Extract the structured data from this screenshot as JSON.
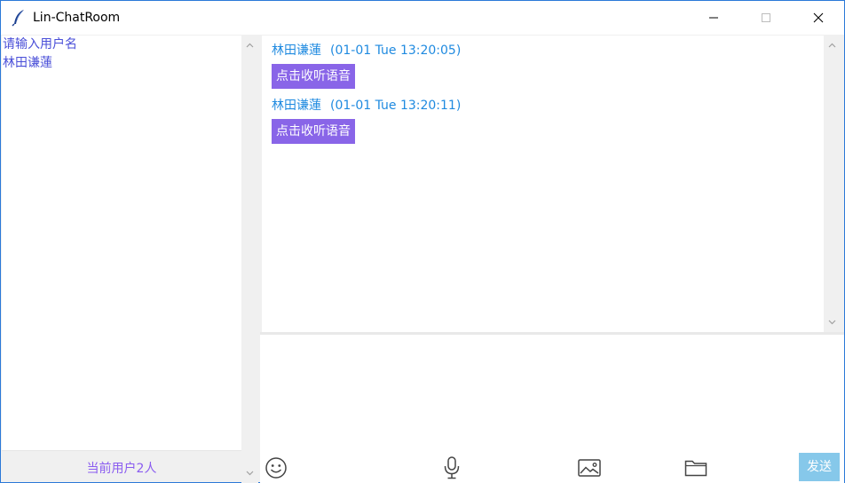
{
  "window": {
    "title": "Lin-ChatRoom",
    "border_color": "#2b79d8"
  },
  "sidebar": {
    "items": [
      {
        "label": "请输入用户名"
      },
      {
        "label": "林田谦蓮"
      }
    ],
    "user_count_label": "当前用户2人",
    "text_color": "#4a4fd8",
    "count_color": "#8a5cf0"
  },
  "messages": [
    {
      "sender": "林田谦蓮",
      "timestamp": "(01-01 Tue 13:20:05)",
      "voice_label": "点击收听语音"
    },
    {
      "sender": "林田谦蓮",
      "timestamp": "(01-01 Tue 13:20:11)",
      "voice_label": "点击收听语音"
    }
  ],
  "colors": {
    "header_text": "#1f8ae0",
    "voice_button_bg": "#8965e8",
    "send_button_bg": "#86c8ea"
  },
  "input": {
    "value": "",
    "placeholder": ""
  },
  "toolbar": {
    "icons": [
      "emoji-icon",
      "microphone-icon",
      "image-icon",
      "folder-icon"
    ],
    "send_label": "发送"
  }
}
